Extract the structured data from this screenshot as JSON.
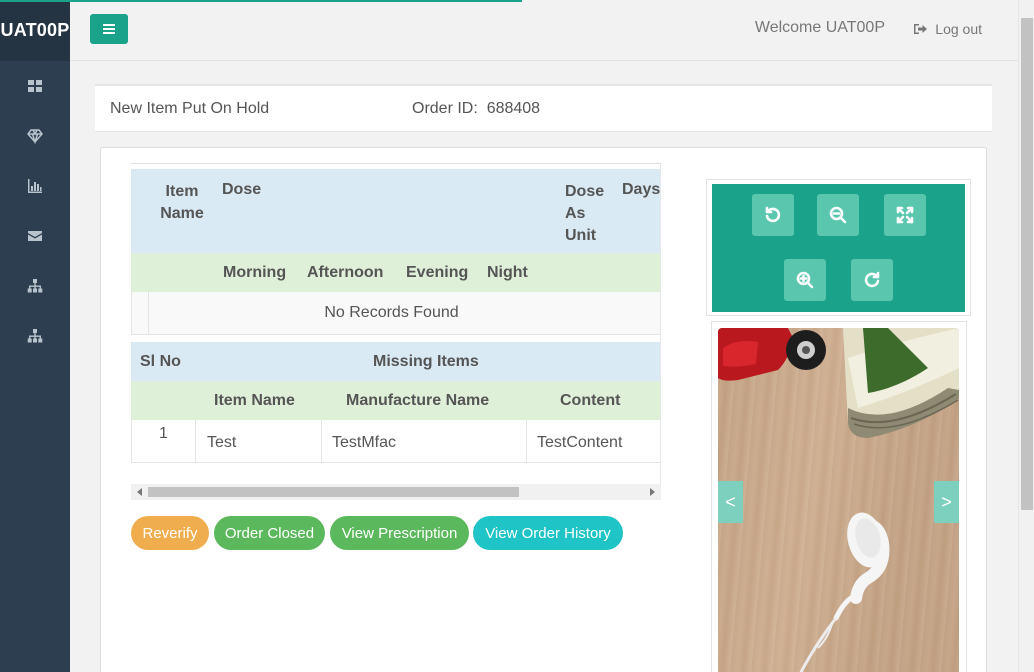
{
  "app": {
    "brand": "UAT00P",
    "welcome": "Welcome UAT00P",
    "logout_label": "Log out"
  },
  "sidebar": {
    "items": [
      {
        "icon": "dashboard-icon"
      },
      {
        "icon": "diamond-icon"
      },
      {
        "icon": "bar-chart-icon"
      },
      {
        "icon": "envelope-icon"
      },
      {
        "icon": "sitemap-icon"
      },
      {
        "icon": "sitemap-icon"
      }
    ]
  },
  "page": {
    "title": "New Item Put On Hold",
    "order_id_label": "Order ID:",
    "order_id": "688408"
  },
  "dose_table": {
    "headers": {
      "item_name": "Item Name",
      "dose": "Dose",
      "dose_as_unit": "Dose As Unit",
      "days": "Days"
    },
    "sub_headers": [
      "Morning",
      "Afternoon",
      "Evening",
      "Night"
    ],
    "empty_message": "No Records Found"
  },
  "missing_table": {
    "sl_no": "Sl No",
    "title": "Missing Items",
    "columns": [
      "Item Name",
      "Manufacture Name",
      "Content"
    ],
    "rows": [
      {
        "sl": "1",
        "item_name": "Test",
        "manufacturer": "TestMfac",
        "content": "TestContent"
      }
    ]
  },
  "actions": {
    "reverify": "Reverify",
    "order_closed": "Order Closed",
    "view_prescription": "View Prescription",
    "view_order_history": "View Order History"
  },
  "viewer": {
    "prev": "<",
    "next": ">"
  },
  "colors": {
    "accent": "#1aa38a",
    "sidebar": "#2c3e50",
    "orange": "#f0ad4e",
    "green": "#5cb85c",
    "teal": "#1fc4c7"
  }
}
